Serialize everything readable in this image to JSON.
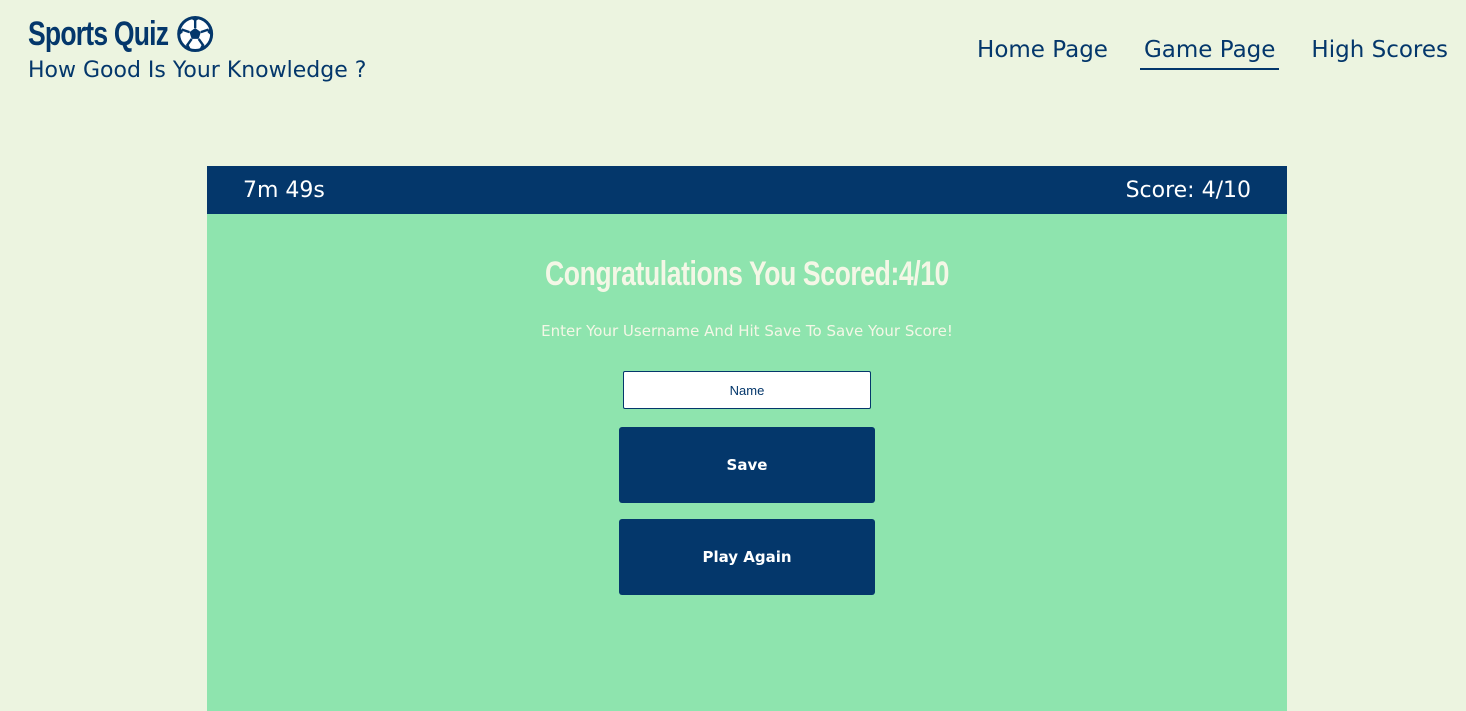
{
  "header": {
    "title": "Sports Quiz",
    "title_icon": "soccer-ball-icon",
    "subtitle": "How Good Is Your Knowledge ?"
  },
  "nav": {
    "items": [
      {
        "label": "Home Page",
        "active": false
      },
      {
        "label": "Game Page",
        "active": true
      },
      {
        "label": "High Scores",
        "active": false
      }
    ]
  },
  "quiz": {
    "timer": "7m 49s",
    "score": "Score: 4/10",
    "result_title": "Congratulations You Scored:4/10",
    "instruction": "Enter Your Username And Hit Save To Save Your Score!",
    "name_placeholder": "Name",
    "name_value": "",
    "save_label": "Save",
    "play_again_label": "Play Again"
  },
  "colors": {
    "page_background": "#ecf4e0",
    "primary": "#04376b",
    "card_background": "#8ee4ae",
    "card_text": "#f4f7e6"
  }
}
